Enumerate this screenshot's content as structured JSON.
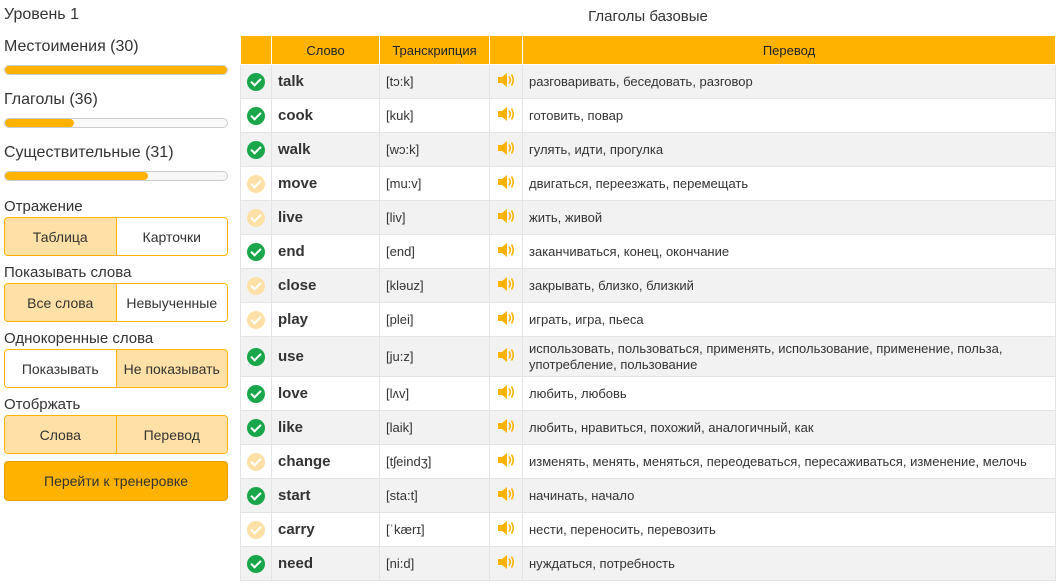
{
  "sidebar": {
    "level": "Уровень 1",
    "categories": [
      {
        "label": "Местоимения (30)",
        "progress": 1.0
      },
      {
        "label": "Глаголы (36)",
        "progress": 0.31
      },
      {
        "label": "Существительные (31)",
        "progress": 0.645
      }
    ],
    "display": {
      "label": "Отражение",
      "options": [
        "Таблица",
        "Карточки"
      ],
      "active": 0
    },
    "show_words": {
      "label": "Показывать слова",
      "options": [
        "Все слова",
        "Невыученные"
      ],
      "active": 0
    },
    "cognates": {
      "label": "Однокоренные слова",
      "options": [
        "Показывать",
        "Не показывать"
      ],
      "active": 1
    },
    "show": {
      "label": "Отобржать",
      "options": [
        "Слова",
        "Перевод"
      ],
      "active": 0,
      "both_active": true
    },
    "go_button": "Перейти к тренеровке"
  },
  "table": {
    "title": "Глаголы базовые",
    "headers": {
      "word": "Слово",
      "transcription": "Транскрипция",
      "translation": "Перевод"
    },
    "accent_color": "#ffb300",
    "rows": [
      {
        "learned": true,
        "word": "talk",
        "tr": "[tɔ:k]",
        "trans": "разговаривать, беседовать, разговор"
      },
      {
        "learned": true,
        "word": "cook",
        "tr": "[kuk]",
        "trans": "готовить, повар"
      },
      {
        "learned": true,
        "word": "walk",
        "tr": "[wɔ:k]",
        "trans": "гулять, идти, прогулка"
      },
      {
        "learned": false,
        "word": "move",
        "tr": "[mu:v]",
        "trans": "двигаться, переезжать, перемещать"
      },
      {
        "learned": false,
        "word": "live",
        "tr": "[liv]",
        "trans": "жить, живой"
      },
      {
        "learned": true,
        "word": "end",
        "tr": "[end]",
        "trans": "заканчиваться, конец, окончание"
      },
      {
        "learned": false,
        "word": "close",
        "tr": "[kləuz]",
        "trans": "закрывать, близко, близкий"
      },
      {
        "learned": false,
        "word": "play",
        "tr": "[plei]",
        "trans": "играть, игра, пьеса"
      },
      {
        "learned": true,
        "word": "use",
        "tr": "[ju:z]",
        "trans": "использовать, пользоваться, применять, использование, применение, польза, употребление, пользование"
      },
      {
        "learned": true,
        "word": "love",
        "tr": "[lʌv]",
        "trans": "любить, любовь"
      },
      {
        "learned": true,
        "word": "like",
        "tr": "[laik]",
        "trans": "любить, нравиться, похожий, аналогичный, как"
      },
      {
        "learned": false,
        "word": "change",
        "tr": "[tʃeindʒ]",
        "trans": "изменять, менять, меняться, переодеваться, пересаживаться, изменение, мелочь"
      },
      {
        "learned": true,
        "word": "start",
        "tr": "[sta:t]",
        "trans": "начинать, начало"
      },
      {
        "learned": false,
        "word": "carry",
        "tr": "[ˈkærɪ]",
        "trans": "нести, переносить, перевозить"
      },
      {
        "learned": true,
        "word": "need",
        "tr": "[ni:d]",
        "trans": "нуждаться, потребность"
      }
    ]
  }
}
